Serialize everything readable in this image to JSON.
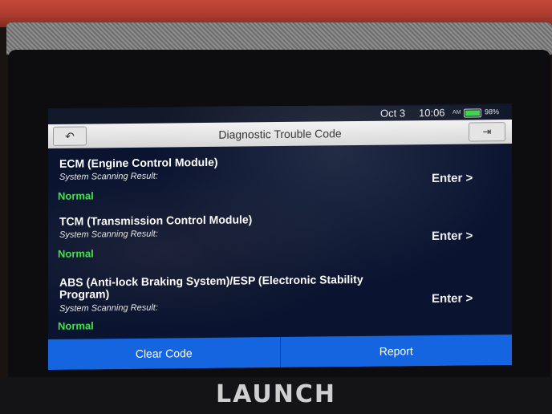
{
  "status_bar": {
    "date": "Oct 3",
    "time": "10:06",
    "am_pm": "AM",
    "battery_pct": "98%",
    "battery_level": 0.98
  },
  "header": {
    "title": "Diagnostic Trouble Code",
    "back_icon": "back-arrow-icon",
    "exit_icon": "exit-icon"
  },
  "modules": [
    {
      "name": "ECM (Engine Control Module)",
      "result_label": "System Scanning Result:",
      "result": "Normal",
      "action": "Enter >"
    },
    {
      "name": "TCM (Transmission Control Module)",
      "result_label": "System Scanning Result:",
      "result": "Normal",
      "action": "Enter >"
    },
    {
      "name": "ABS (Anti-lock Braking System)/ESP (Electronic Stability Program)",
      "result_label": "System Scanning Result:",
      "result": "Normal",
      "action": "Enter >"
    }
  ],
  "footer": {
    "clear_code": "Clear Code",
    "report": "Report"
  },
  "device": {
    "brand": "LAUNCH"
  },
  "colors": {
    "accent_blue": "#1565e0",
    "status_normal": "#3fe24a",
    "screen_bg": "#0a1430"
  }
}
